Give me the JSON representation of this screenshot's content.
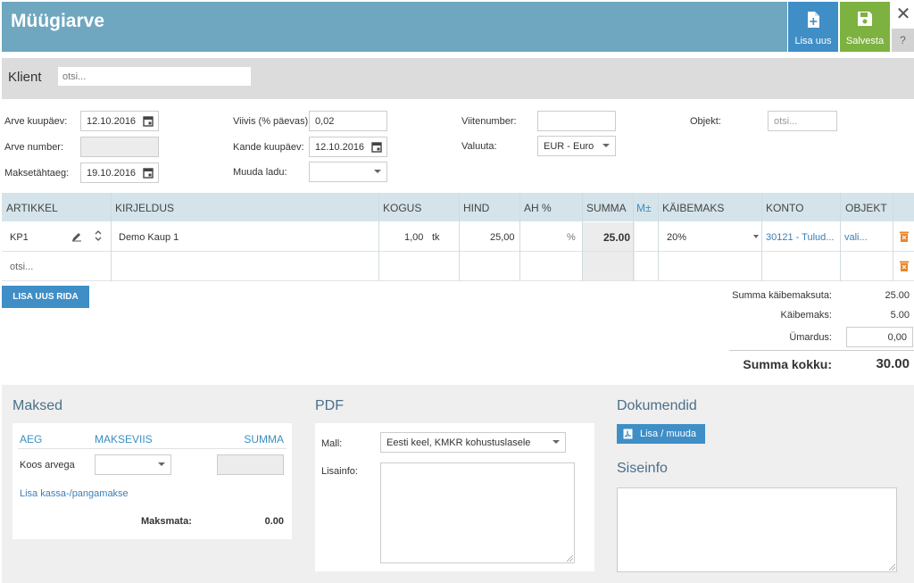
{
  "header": {
    "title": "Müügiarve",
    "add_label": "Lisa uus",
    "save_label": "Salvesta",
    "close_glyph": "✕",
    "help_glyph": "?"
  },
  "client": {
    "label": "Klient",
    "search_placeholder": "otsi..."
  },
  "form": {
    "invoice_date_label": "Arve kuupäev:",
    "invoice_date": "12.10.2016",
    "invoice_number_label": "Arve number:",
    "due_date_label": "Maksetähtaeg:",
    "due_date": "19.10.2016",
    "penalty_label": "Viivis (% päevas):",
    "penalty": "0,02",
    "entry_date_label": "Kande kuupäev:",
    "entry_date": "12.10.2016",
    "warehouse_label": "Muuda ladu:",
    "warehouse": "",
    "reference_label": "Viitenumber:",
    "reference": "",
    "currency_label": "Valuuta:",
    "currency": "EUR - Euro",
    "object_label": "Objekt:",
    "object_placeholder": "otsi..."
  },
  "table": {
    "headers": {
      "artikkel": "ARTIKKEL",
      "kirjeldus": "KIRJELDUS",
      "kogus": "KOGUS",
      "hind": "HIND",
      "ah": "AH %",
      "summa": "SUMMA",
      "mpm": "M±",
      "kaibemaks": "KÄIBEMAKS",
      "konto": "KONTO",
      "objekt": "OBJEKT"
    },
    "rows": [
      {
        "artikkel": "KP1",
        "kirjeldus": "Demo Kaup 1",
        "kogus": "1,00",
        "unit": "tk",
        "hind": "25,00",
        "ah": "%",
        "summa": "25.00",
        "kaibemaks": "20%",
        "konto": "30121 - Tulud...",
        "objekt": "vali..."
      }
    ],
    "new_row_placeholder": "otsi..."
  },
  "add_row_label": "LISA UUS RIDA",
  "totals": {
    "net_label": "Summa käibemaksuta:",
    "net": "25.00",
    "vat_label": "Käibemaks:",
    "vat": "5.00",
    "rounding_label": "Ümardus:",
    "rounding": "0,00",
    "total_label": "Summa kokku:",
    "total": "30.00"
  },
  "payments": {
    "title": "Maksed",
    "col_date": "AEG",
    "col_method": "MAKSEVIIS",
    "col_sum": "SUMMA",
    "row_label": "Koos arvega",
    "add_link": "Lisa kassa-/pangamakse",
    "unpaid_label": "Maksmata:",
    "unpaid": "0.00"
  },
  "pdf": {
    "title": "PDF",
    "template_label": "Mall:",
    "template": "Eesti keel, KMKR kohustuslasele",
    "extra_label": "Lisainfo:"
  },
  "documents": {
    "title": "Dokumendid",
    "button": "Lisa / muuda"
  },
  "internal": {
    "title": "Siseinfo"
  },
  "colors": {
    "header_bg": "#6ea7bf",
    "primary_blue": "#3f8ec6",
    "save_green": "#7db241",
    "delete_orange": "#e8862a"
  }
}
